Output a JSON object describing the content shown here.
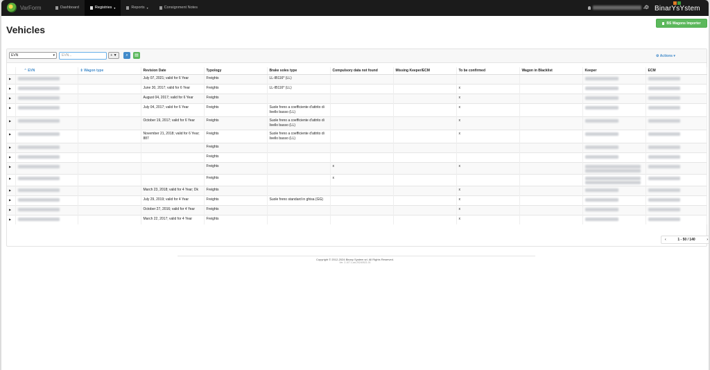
{
  "app": {
    "name": "VarForm",
    "company": "BinarYsYstem"
  },
  "nav": [
    {
      "label": "Dashboard",
      "icon": "dashboard-icon",
      "active": false
    },
    {
      "label": "Registries",
      "icon": "registry-icon",
      "active": true,
      "dropdown": true
    },
    {
      "label": "Reports",
      "icon": "report-icon",
      "active": false,
      "dropdown": true
    },
    {
      "label": "Consignment Notes",
      "icon": "document-icon",
      "active": false
    }
  ],
  "page": {
    "title": "Vehicles",
    "importer_label": "BS Wagons Importer"
  },
  "toolbar": {
    "search_field": "EVN",
    "search_placeholder": "EVN...",
    "filter_label": "+ ▼",
    "actions_label": "Actions"
  },
  "columns": [
    "EVN",
    "Wagon type",
    "Revision Date",
    "Typology",
    "Brake soles type",
    "Compulsory data not found",
    "Missing Keeper/ECM",
    "To be confirmed",
    "Wagon in Blacklist",
    "Keeper",
    "ECM"
  ],
  "rows": [
    {
      "revision": "July 07, 2021; valid for 6 Year",
      "typology": "Freights",
      "brake": "LL-IB116* (LL)",
      "compulsory": "",
      "confirm": "",
      "keeper_lines": 1,
      "ecm": true
    },
    {
      "revision": "June 30, 2017; valid for 6 Year",
      "typology": "Freights",
      "brake": "LL-IB116* (LL)",
      "compulsory": "",
      "confirm": "x",
      "keeper_lines": 1,
      "ecm": true
    },
    {
      "revision": "August 04, 2017; valid for 6 Year",
      "typology": "Freights",
      "brake": "",
      "compulsory": "",
      "confirm": "x",
      "keeper_lines": 1,
      "ecm": true
    },
    {
      "revision": "July 04, 2017; valid for 6 Year",
      "typology": "Freights",
      "brake": "Suole freno a coefficiente d'attrito di livello basso (LL)",
      "compulsory": "",
      "confirm": "x",
      "keeper_lines": 1,
      "ecm": true
    },
    {
      "revision": "October 19, 2017; valid for 6 Year",
      "typology": "Freights",
      "brake": "Suole freno a coefficiente d'attrito di livello basso (LL)",
      "compulsory": "",
      "confirm": "x",
      "keeper_lines": 1,
      "ecm": true
    },
    {
      "revision": "November 21, 2018; valid for 6 Year; 887",
      "typology": "Freights",
      "brake": "Suole freno a coefficiente d'attrito di livello basso (LL)",
      "compulsory": "",
      "confirm": "x",
      "keeper_lines": 1,
      "ecm": true
    },
    {
      "revision": "",
      "typology": "Freights",
      "brake": "",
      "compulsory": "",
      "confirm": "",
      "keeper_lines": 1,
      "ecm": true
    },
    {
      "revision": "",
      "typology": "Freights",
      "brake": "",
      "compulsory": "",
      "confirm": "",
      "keeper_lines": 1,
      "ecm": true
    },
    {
      "revision": "",
      "typology": "Freights",
      "brake": "",
      "compulsory": "x",
      "confirm": "x",
      "keeper_lines": 2,
      "ecm": true
    },
    {
      "revision": "",
      "typology": "Freights",
      "brake": "",
      "compulsory": "x",
      "confirm": "",
      "keeper_lines": 2,
      "ecm": true
    },
    {
      "revision": "March 23, 2018; valid for 4 Year; Dk",
      "typology": "Freights",
      "brake": "",
      "compulsory": "",
      "confirm": "x",
      "keeper_lines": 1,
      "ecm": true
    },
    {
      "revision": "July 29, 2019; valid for 4 Year",
      "typology": "Freights",
      "brake": "Suole freno standard in ghisa (GG)",
      "compulsory": "",
      "confirm": "x",
      "keeper_lines": 1,
      "ecm": true
    },
    {
      "revision": "October 27, 2016; valid for 4 Year",
      "typology": "Freights",
      "brake": "",
      "compulsory": "",
      "confirm": "x",
      "keeper_lines": 1,
      "ecm": true
    },
    {
      "revision": "March 22, 2017; valid for 4 Year",
      "typology": "Freights",
      "brake": "",
      "compulsory": "",
      "confirm": "x",
      "keeper_lines": 1,
      "ecm": true
    }
  ],
  "pagination": {
    "label": "1 - 50 / 140"
  },
  "footer": {
    "copyright": "Copyright © 2012-2024 Binary System srl. All Rights Reserved.",
    "version": "Ver. 2.107.1-ad.20240521-01"
  },
  "colors": {
    "accent": "#428bca",
    "success": "#5cb85c",
    "nav_bg": "#1b1b1b"
  }
}
